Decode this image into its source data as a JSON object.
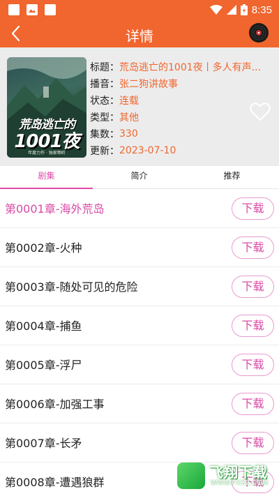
{
  "status_bar": {
    "time": "8:35",
    "left_icons": [
      "notification-icon",
      "image-icon",
      "notification-icon"
    ],
    "right_icons": [
      "wifi-icon",
      "signal-icon",
      "battery-icon"
    ]
  },
  "app_bar": {
    "title": "详情",
    "back_icon": "chevron-left-icon",
    "player_icon": "vinyl-disc-icon"
  },
  "book": {
    "cover": {
      "title_top": "荒岛逃亡的",
      "title_big": "1001夜",
      "caption": "年度力作 · 独家畅听"
    },
    "meta": [
      {
        "label": "标题：",
        "value": "荒岛逃亡的1001夜丨多人有声..."
      },
      {
        "label": "播音：",
        "value": "张二狗讲故事"
      },
      {
        "label": "状态：",
        "value": "连载"
      },
      {
        "label": "类型：",
        "value": "其他"
      },
      {
        "label": "集数：",
        "value": "330"
      },
      {
        "label": "更新：",
        "value": "2023-07-10"
      }
    ],
    "favorite_icon": "heart-outline-icon"
  },
  "tabs": [
    {
      "label": "剧集",
      "active": true
    },
    {
      "label": "简介",
      "active": false
    },
    {
      "label": "推荐",
      "active": false
    }
  ],
  "chapters": [
    {
      "title": "第0001章-海外荒岛",
      "action": "下载",
      "active": true
    },
    {
      "title": "第0002章-火种",
      "action": "下载",
      "active": false
    },
    {
      "title": "第0003章-随处可见的危险",
      "action": "下载",
      "active": false
    },
    {
      "title": "第0004章-捕鱼",
      "action": "下载",
      "active": false
    },
    {
      "title": "第0005章-浮尸",
      "action": "下载",
      "active": false
    },
    {
      "title": "第0006章-加强工事",
      "action": "下载",
      "active": false
    },
    {
      "title": "第0007章-长矛",
      "action": "下载",
      "active": false
    },
    {
      "title": "第0008章-遭遇狼群",
      "action": "下载",
      "active": false
    }
  ],
  "watermark": {
    "text": "飞翔下载",
    "url": "WWW.FXXZ.COM"
  },
  "colors": {
    "accent": "#f0662e",
    "active_text": "#d84aa6",
    "button_border": "#e79ad0",
    "info_bg": "#ececec"
  }
}
